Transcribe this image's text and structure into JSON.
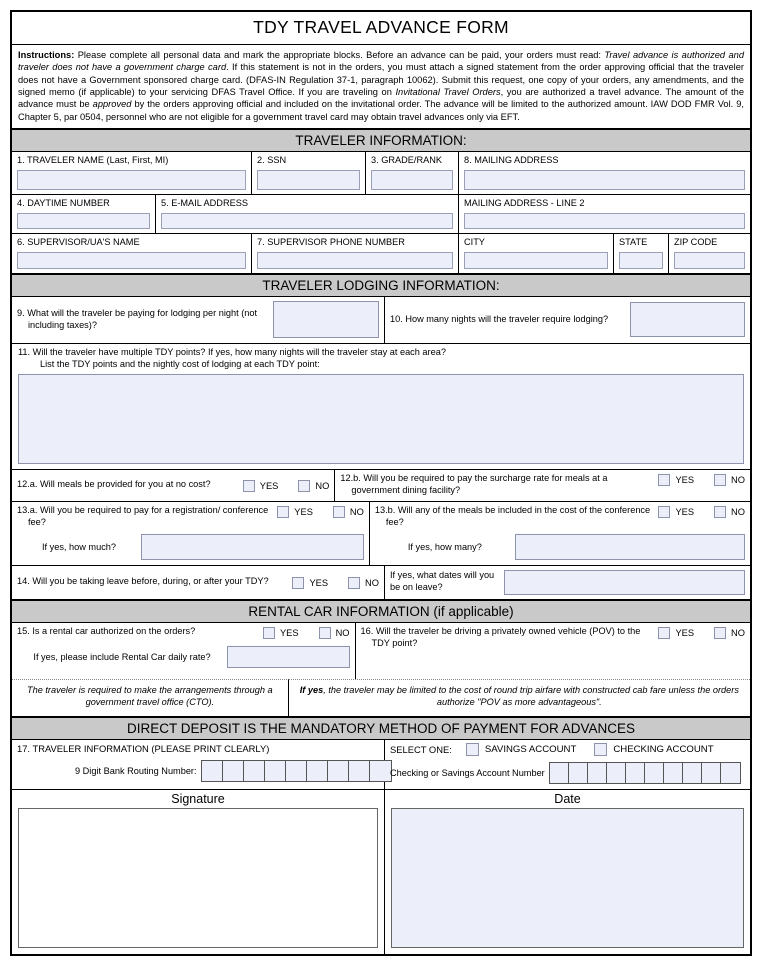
{
  "form": {
    "title": "TDY TRAVEL ADVANCE FORM",
    "instructions_label": "Instructions:",
    "instructions_p1": " Please complete all personal data and mark the appropriate blocks. Before an advance can be paid, your orders must read: ",
    "instructions_i1": "Travel advance is authorized and traveler does not have a government charge card",
    "instructions_p2": ". If this statement is not in the orders, you must attach a signed statement from the order approving official that the traveler does not have a Government sponsored charge card. (DFAS-IN Regulation 37-1, paragraph 10062). Submit this request, one copy of your orders, any amendments, and the signed memo (if applicable) to your servicing DFAS Travel Office. If you are traveling on ",
    "instructions_i2": "Invitational Travel Orders",
    "instructions_p3": ", you are authorized a travel advance. The amount of the advance must be ",
    "instructions_i3": "approved",
    "instructions_p4": " by the orders approving official and included on the invitational order. The advance will be limited to the authorized amount. IAW DOD FMR Vol. 9, Chapter 5, par 0504, personnel who are not eligible for a government travel card may obtain travel advances only via EFT."
  },
  "sections": {
    "traveler_information": "TRAVELER INFORMATION:",
    "traveler_lodging": "TRAVELER LODGING INFORMATION:",
    "rental_car": "RENTAL CAR INFORMATION (if applicable)",
    "direct_deposit": "DIRECT DEPOSIT IS THE MANDATORY METHOD OF PAYMENT FOR ADVANCES"
  },
  "traveler": {
    "name": "1. TRAVELER NAME (Last, First, MI)",
    "ssn": "2. SSN",
    "grade_rank": "3. GRADE/RANK",
    "mailing_address": "8. MAILING ADDRESS",
    "daytime_number": "4. DAYTIME NUMBER",
    "email": "5. E-MAIL ADDRESS",
    "mailing_address_2": "MAILING ADDRESS - LINE 2",
    "supervisor_name": "6. SUPERVISOR/UA'S NAME",
    "supervisor_phone": "7. SUPERVISOR PHONE NUMBER",
    "city": "CITY",
    "state": "STATE",
    "zip": "ZIP CODE"
  },
  "lodging": {
    "q9": "9. What will the traveler be paying for lodging per night (not including taxes)?",
    "q10": "10. How many nights will the traveler require lodging?",
    "q11_line1": "11. Will the traveler have multiple TDY points? If yes, how many nights will the traveler stay at each area?",
    "q11_line2": "List the TDY points and the nightly cost of lodging at each TDY point:"
  },
  "questions": {
    "q12a": "12.a. Will meals be provided for you at no cost?",
    "q12b": "12.b. Will you be required to pay the surcharge rate for meals at a government dining facility?",
    "q13a": "13.a. Will you be required to pay for a registration/ conference fee?",
    "q13a_sub": "If yes, how much?",
    "q13b": "13.b. Will any of the meals be included in the cost of the conference fee?",
    "q13b_sub": "If yes, how many?",
    "q14": "14. Will you be taking leave before, during, or after your TDY?",
    "q14_sub": "If yes, what dates will you be on leave?",
    "q15": "15. Is a rental car authorized on the orders?",
    "q15_sub": "If yes, please include Rental Car daily rate?",
    "q15_note": "The traveler is required to make the arrangements through a government travel office (CTO).",
    "q16": "16. Will the traveler be driving a privately owned vehicle (POV) to the TDY point?",
    "q16_note_bold": "If yes",
    "q16_note_rest": ", the traveler may be limited to the cost of round trip airfare with constructed cab fare unless the orders authorize \"POV as more advantageous\"."
  },
  "yes_label": "YES",
  "no_label": "NO",
  "deposit": {
    "q17": "17. TRAVELER INFORMATION (PLEASE PRINT CLEARLY)",
    "select_one": "SELECT ONE:",
    "savings": "SAVINGS ACCOUNT",
    "checking": "CHECKING ACCOUNT",
    "routing_label": "9 Digit Bank Routing Number:",
    "account_label": "Checking or Savings Account Number",
    "routing_box_count": 9,
    "account_box_count": 10
  },
  "footer": {
    "signature": "Signature",
    "date": "Date"
  },
  "colors": {
    "section_bar": "#c9c9c9",
    "field_fill": "#eceefa",
    "field_border": "#8d93ab",
    "rule": "#000000"
  }
}
